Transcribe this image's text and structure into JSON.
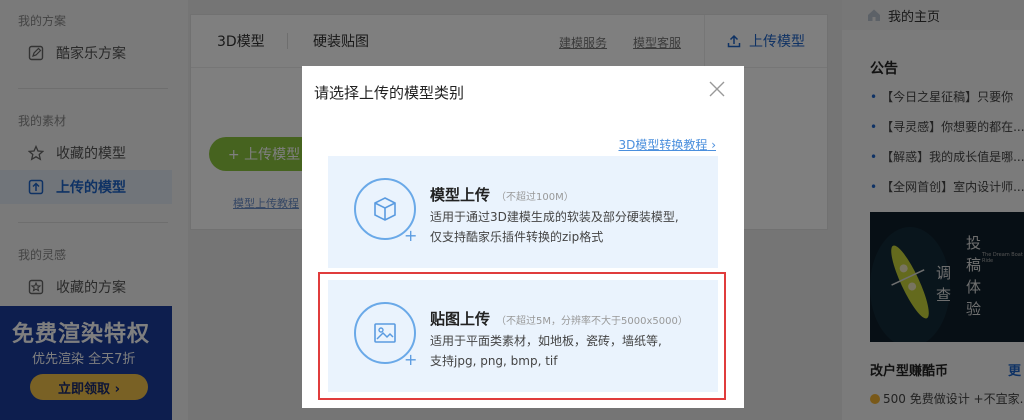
{
  "sidebar": {
    "section_plan": "我的方案",
    "plan_item": "酷家乐方案",
    "section_material": "我的素材",
    "material_items": [
      "收藏的模型",
      "上传的模型"
    ],
    "section_inspiration": "我的灵感",
    "inspiration_item": "收藏的方案",
    "promo": {
      "title": "免费渲染特权",
      "subtitle": "优先渲染 全天7折",
      "cta": "立即领取 ›"
    }
  },
  "main": {
    "tabs": [
      "3D模型",
      "硬装贴图"
    ],
    "links": [
      "建模服务",
      "模型客服"
    ],
    "upload_top": "上传模型",
    "green_button": "+ 上传模型",
    "tutorial_link": "模型上传教程"
  },
  "right": {
    "homepage": "我的主页",
    "notice_title": "公告",
    "notices": [
      "【今日之星征稿】只要你",
      "【寻灵感】你想要的都在...",
      "【解惑】我的成长值是哪...",
      "【全网首创】室内设计师..."
    ],
    "promo_text": [
      "投",
      "稿",
      "体",
      "验",
      "调",
      "查"
    ],
    "promo_small": "The Dream Boat Ride",
    "bottom_title": "改户型赚酷币",
    "bottom_more": "更",
    "bottom_line": "500 免费做设计 +不宜家..."
  },
  "modal": {
    "title": "请选择上传的模型类别",
    "tutorial_link": "3D模型转换教程",
    "cards": [
      {
        "title": "模型上传",
        "note": "（不超过100M）",
        "desc1": "适用于通过3D建模生成的软装及部分硬装模型,",
        "desc2": "仅支持酷家乐插件转换的zip格式"
      },
      {
        "title": "贴图上传",
        "note": "（不超过5M，分辨率不大于5000x5000）",
        "desc1": "适用于平面类素材，如地板，瓷砖，墙纸等,",
        "desc2": "支持jpg, png, bmp, tif"
      }
    ]
  },
  "colors": {
    "accent_blue": "#1e64c8",
    "card_bg": "#eaf3fd",
    "highlight_red": "#e03c3c",
    "green": "#8cc63f"
  }
}
